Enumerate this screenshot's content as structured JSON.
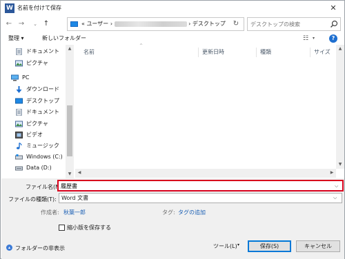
{
  "window": {
    "title": "名前を付けて保存",
    "app_icon": "W",
    "close_glyph": "✕"
  },
  "address": {
    "pc_icon": "computer-icon",
    "breadcrumb_prefix": "« ユーザー ›",
    "breadcrumb_suffix": "› デスクトップ",
    "dropdown_glyph": "⌵",
    "refresh_glyph": "↻",
    "search_placeholder": "デスクトップの検索"
  },
  "nav_buttons": {
    "back": "←",
    "forward": "→",
    "recent": "⌄",
    "up": "↑"
  },
  "toolbar": {
    "organize_label": "整理 ▾",
    "new_folder_label": "新しいフォルダー",
    "view_glyph": "☷",
    "view_dd": "▾",
    "help_glyph": "?"
  },
  "nav_pane": {
    "items": [
      {
        "label": "ドキュメント",
        "icon": "document-icon",
        "indent": true
      },
      {
        "label": "ピクチャ",
        "icon": "picture-icon",
        "indent": true
      },
      {
        "label": "PC",
        "icon": "computer-icon",
        "indent": false
      },
      {
        "label": "ダウンロード",
        "icon": "download-icon",
        "indent": true
      },
      {
        "label": "デスクトップ",
        "icon": "desktop-icon",
        "indent": true
      },
      {
        "label": "ドキュメント",
        "icon": "document-icon",
        "indent": true
      },
      {
        "label": "ピクチャ",
        "icon": "picture-icon",
        "indent": true
      },
      {
        "label": "ビデオ",
        "icon": "video-icon",
        "indent": true
      },
      {
        "label": "ミュージック",
        "icon": "music-icon",
        "indent": true
      },
      {
        "label": "Windows (C:)",
        "icon": "drive-icon",
        "indent": true
      },
      {
        "label": "Data (D:)",
        "icon": "drive-icon",
        "indent": true
      }
    ]
  },
  "file_list": {
    "columns": [
      "名前",
      "更新日時",
      "種類",
      "サイズ"
    ],
    "sort_glyph": "^"
  },
  "form": {
    "filename_label": "ファイル名(N):",
    "filename_value": "履歴書",
    "filetype_label": "ファイルの種類(T):",
    "filetype_value": "Word 文書",
    "author_label": "作成者:",
    "author_value": "秋葉一郎",
    "tags_label": "タグ:",
    "tags_value": "タグの追加",
    "thumbnail_label": "縮小版を保存する",
    "hide_folders_label": "フォルダーの非表示",
    "hide_folders_glyph": "▴",
    "tools_label": "ツール(L)",
    "tools_dd": "▾",
    "save_label": "保存(S)",
    "cancel_label": "キャンセル",
    "dd_glyph": "⌵"
  }
}
